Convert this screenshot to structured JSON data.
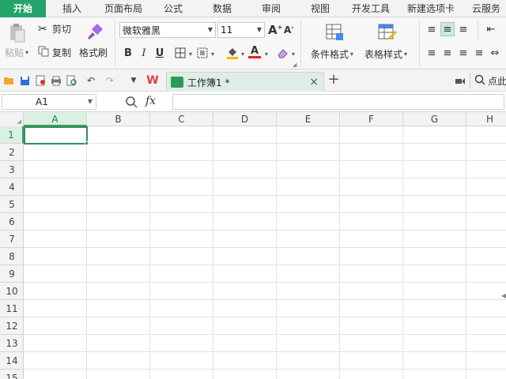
{
  "ribbon_tabs": [
    {
      "label": "开始",
      "active": true
    },
    {
      "label": "插入"
    },
    {
      "label": "页面布局"
    },
    {
      "label": "公式"
    },
    {
      "label": "数据"
    },
    {
      "label": "审阅"
    },
    {
      "label": "视图"
    },
    {
      "label": "开发工具"
    },
    {
      "label": "新建选项卡"
    },
    {
      "label": "云服务"
    }
  ],
  "clipboard": {
    "paste_label": "粘贴",
    "cut_label": "剪切",
    "copy_label": "复制",
    "format_painter_label": "格式刷"
  },
  "font": {
    "family": "微软雅黑",
    "size": "11",
    "bold": "B",
    "italic": "I",
    "underline": "U",
    "font_color": "A",
    "increase": "A",
    "decrease": "A"
  },
  "styles": {
    "conditional_format_label": "条件格式",
    "table_style_label": "表格样式"
  },
  "quick_access": {
    "wps_logo": "W",
    "doc_tab_label": "工作簿1 *",
    "close": "×",
    "new_tab": "+",
    "search_label": "点此"
  },
  "formula_bar": {
    "cell_ref": "A1",
    "fx_label": "fx",
    "value": ""
  },
  "columns": [
    "A",
    "B",
    "C",
    "D",
    "E",
    "F",
    "G",
    "H"
  ],
  "rows": [
    "1",
    "2",
    "3",
    "4",
    "5",
    "6",
    "7",
    "8",
    "9",
    "10",
    "11",
    "12",
    "13",
    "14",
    "15"
  ],
  "colors": {
    "accent": "#24a36b",
    "selection": "#2f8f56"
  },
  "icons": {
    "paste": "paste-icon",
    "cut": "scissors-icon",
    "copy": "copy-icon",
    "format_painter": "brush-icon"
  }
}
